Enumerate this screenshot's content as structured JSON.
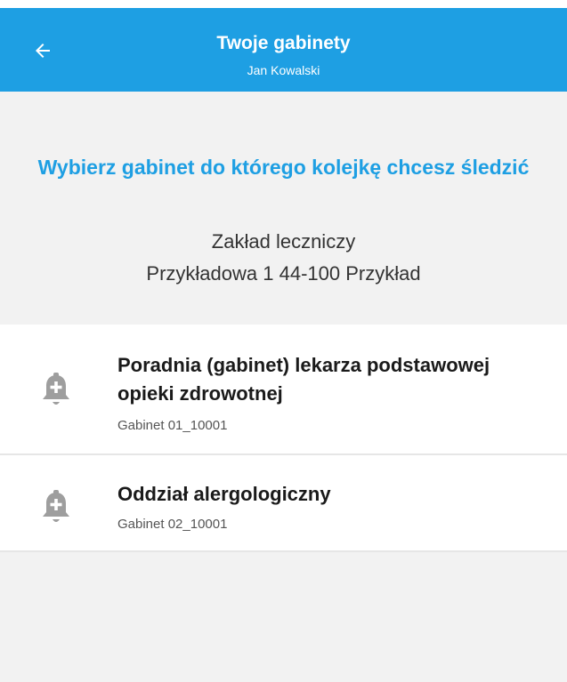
{
  "appbar": {
    "back_icon": "arrow-left-icon",
    "title": "Twoje gabinety",
    "subtitle": "Jan Kowalski",
    "background_color": "#1e9fe3"
  },
  "header": {
    "prompt": "Wybierz gabinet do którego kolejkę chcesz śledzić",
    "prompt_color": "#1e9fe3",
    "facility_name": "Zakład leczniczy",
    "facility_address": "Przykładowa 1 44-100 Przykład"
  },
  "clinics": [
    {
      "icon": "bell-plus-icon",
      "name": "Poradnia (gabinet) lekarza podstawowej opieki zdrowotnej",
      "room": "Gabinet 01_10001"
    },
    {
      "icon": "bell-plus-icon",
      "name": "Oddział alergologiczny",
      "room": "Gabinet 02_10001"
    }
  ]
}
